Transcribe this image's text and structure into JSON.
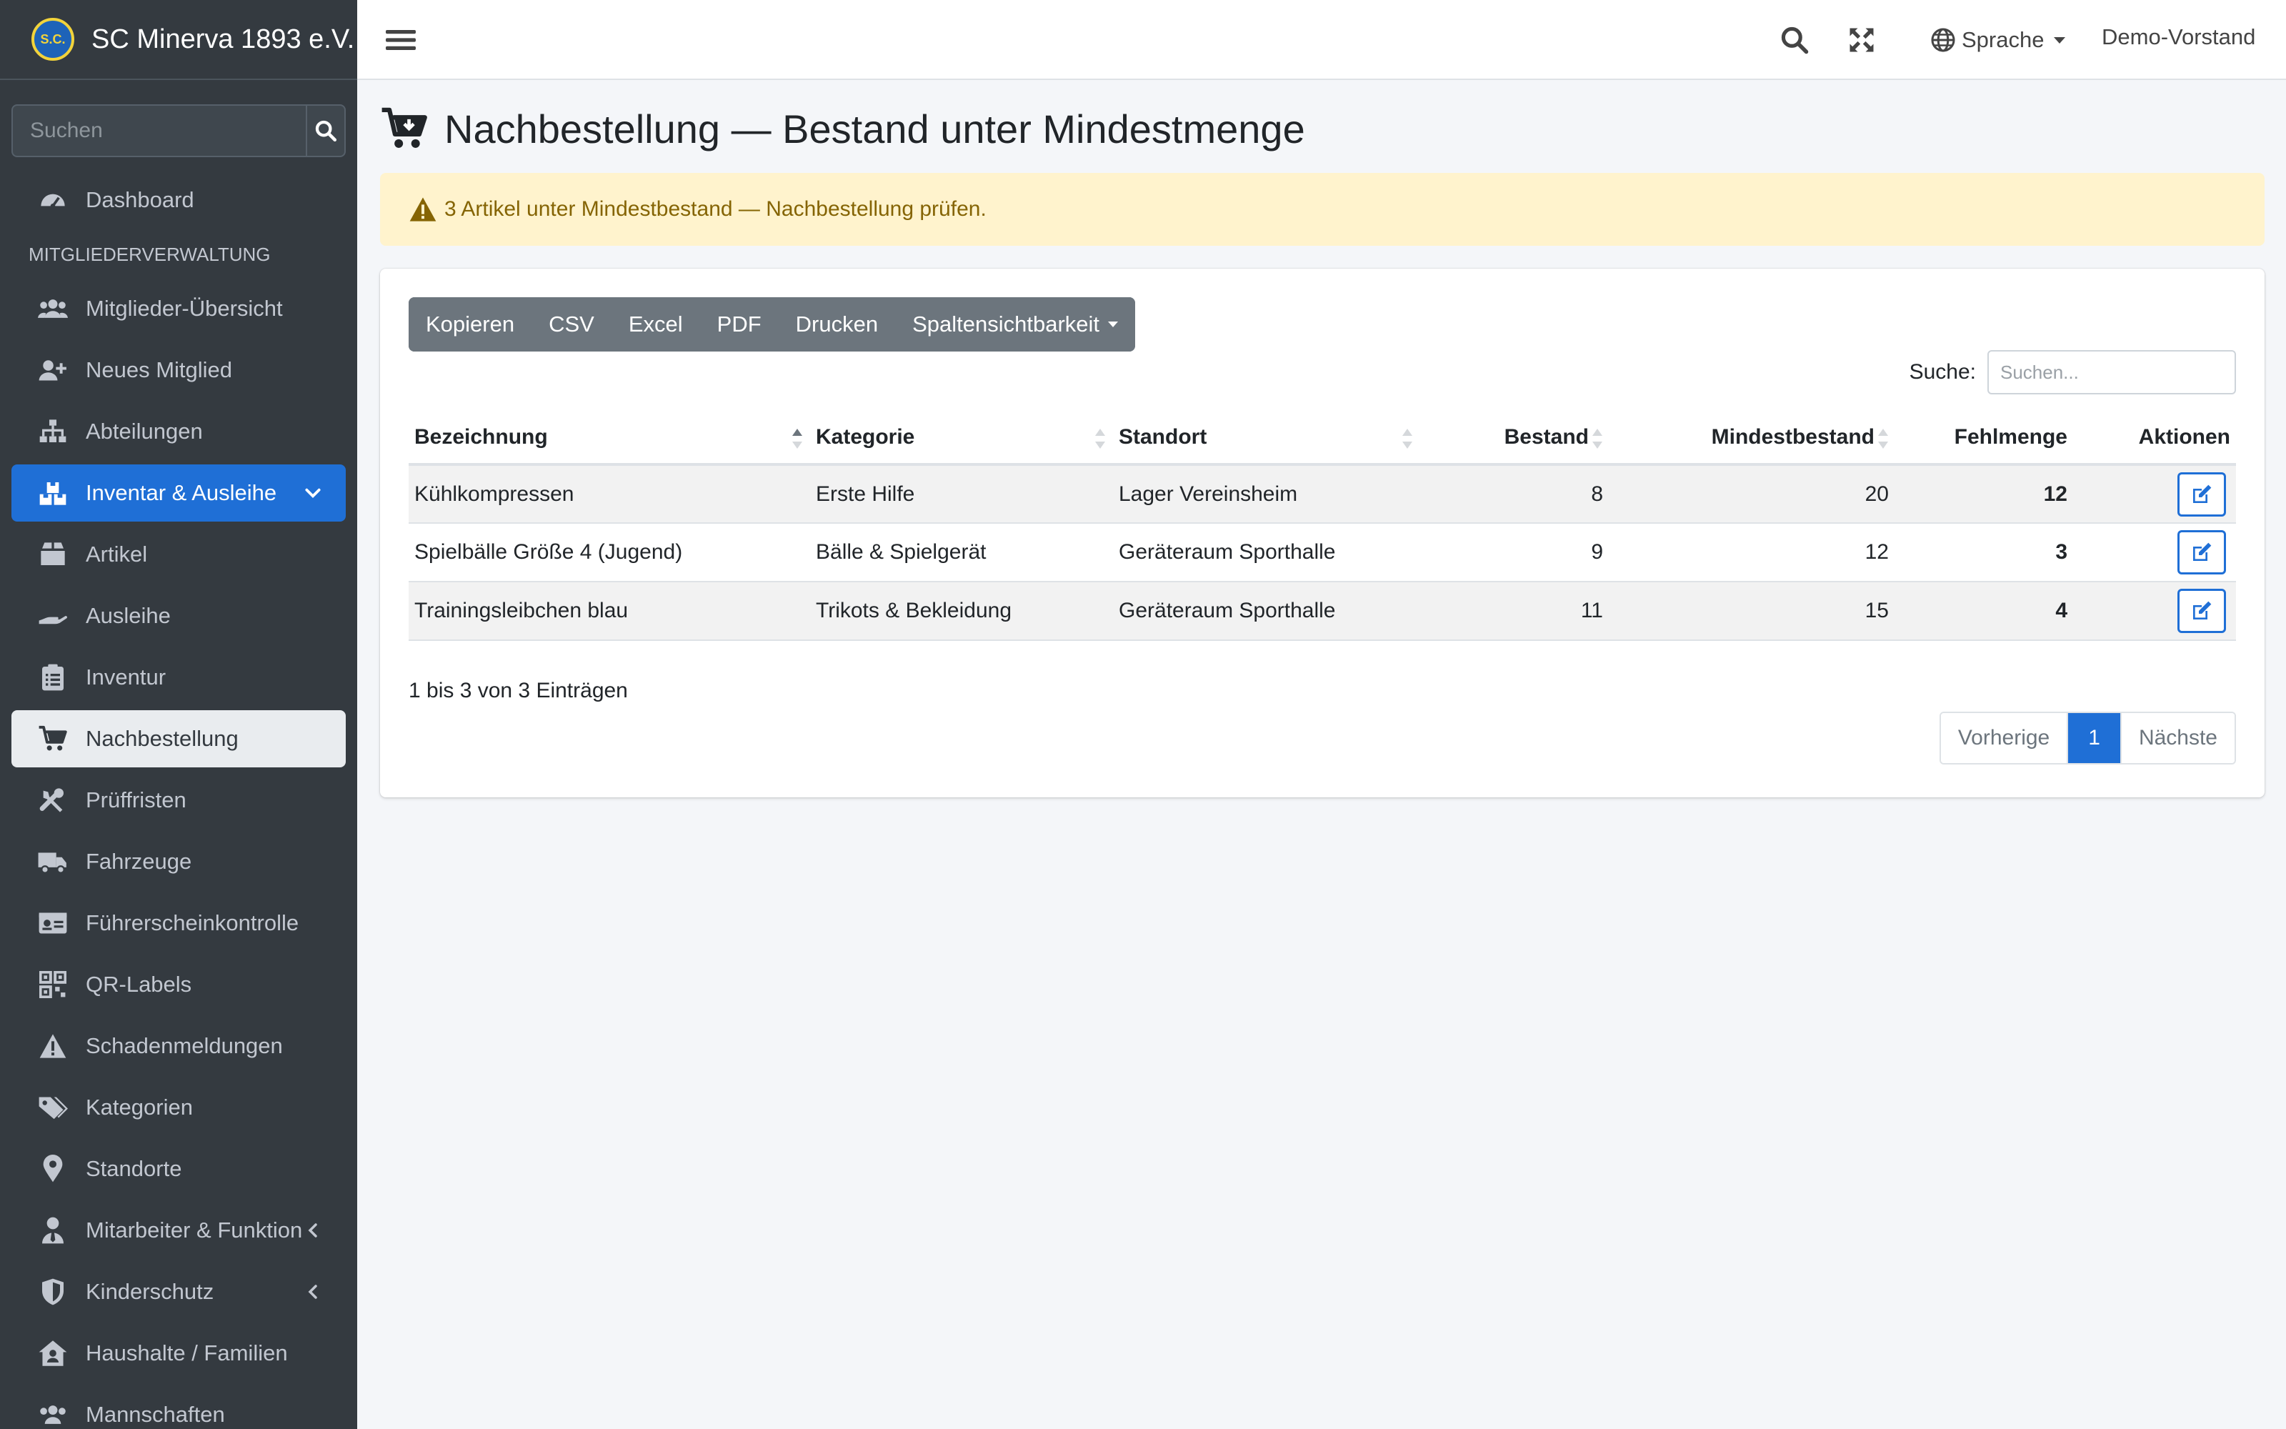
{
  "brand": {
    "name": "SC Minerva 1893 e.V.",
    "logo_text": "S.C."
  },
  "sidebar": {
    "search_placeholder": "Suchen",
    "section_header": "MITGLIEDERVERWALTUNG",
    "items": [
      {
        "label": "Dashboard",
        "icon": "dashboard-icon"
      },
      {
        "label": "Mitglieder-Übersicht",
        "icon": "users-icon"
      },
      {
        "label": "Neues Mitglied",
        "icon": "user-plus-icon"
      },
      {
        "label": "Abteilungen",
        "icon": "sitemap-icon"
      },
      {
        "label": "Inventar & Ausleihe",
        "icon": "boxes-icon",
        "state": "expanded"
      },
      {
        "label": "Artikel",
        "icon": "box-icon"
      },
      {
        "label": "Ausleihe",
        "icon": "hand-holding-icon"
      },
      {
        "label": "Inventur",
        "icon": "clipboard-list-icon"
      },
      {
        "label": "Nachbestellung",
        "icon": "cart-icon",
        "state": "selected"
      },
      {
        "label": "Prüffristen",
        "icon": "tools-icon"
      },
      {
        "label": "Fahrzeuge",
        "icon": "truck-icon"
      },
      {
        "label": "Führerscheinkontrolle",
        "icon": "id-card-icon"
      },
      {
        "label": "QR-Labels",
        "icon": "qrcode-icon"
      },
      {
        "label": "Schadenmeldungen",
        "icon": "warning-icon"
      },
      {
        "label": "Kategorien",
        "icon": "tags-icon"
      },
      {
        "label": "Standorte",
        "icon": "map-marker-icon"
      },
      {
        "label": "Mitarbeiter & Funktion",
        "icon": "user-tie-icon"
      },
      {
        "label": "Kinderschutz",
        "icon": "shield-icon"
      },
      {
        "label": "Haushalte / Familien",
        "icon": "house-user-icon"
      },
      {
        "label": "Mannschaften",
        "icon": "team-icon"
      }
    ]
  },
  "topbar": {
    "language": "Sprache",
    "user": "Demo-Vorstand"
  },
  "page": {
    "title": "Nachbestellung — Bestand unter Mindestmenge"
  },
  "alert": {
    "text": "3 Artikel unter Mindestbestand — Nachbestellung prüfen."
  },
  "toolbar": {
    "copy": "Kopieren",
    "csv": "CSV",
    "excel": "Excel",
    "pdf": "PDF",
    "print": "Drucken",
    "columns": "Spaltensichtbarkeit"
  },
  "table_search": {
    "label": "Suche:",
    "placeholder": "Suchen..."
  },
  "table": {
    "columns": [
      "Bezeichnung",
      "Kategorie",
      "Standort",
      "Bestand",
      "Mindestbestand",
      "Fehlmenge",
      "Aktionen"
    ],
    "rows": [
      [
        "Kühlkompressen",
        "Erste Hilfe",
        "Lager Vereinsheim",
        "8",
        "20",
        "12"
      ],
      [
        "Spielbälle Größe 4 (Jugend)",
        "Bälle & Spielgerät",
        "Geräteraum Sporthalle",
        "9",
        "12",
        "3"
      ],
      [
        "Trainingsleibchen blau",
        "Trikots & Bekleidung",
        "Geräteraum Sporthalle",
        "11",
        "15",
        "4"
      ]
    ]
  },
  "info": "1 bis 3 von 3 Einträgen",
  "pager": {
    "prev": "Vorherige",
    "current": "1",
    "next": "Nächste"
  },
  "colors": {
    "accent": "#1f6fd6",
    "sidebar_bg": "#343a40",
    "alert_bg": "#fff3cd",
    "alert_text": "#856404"
  }
}
